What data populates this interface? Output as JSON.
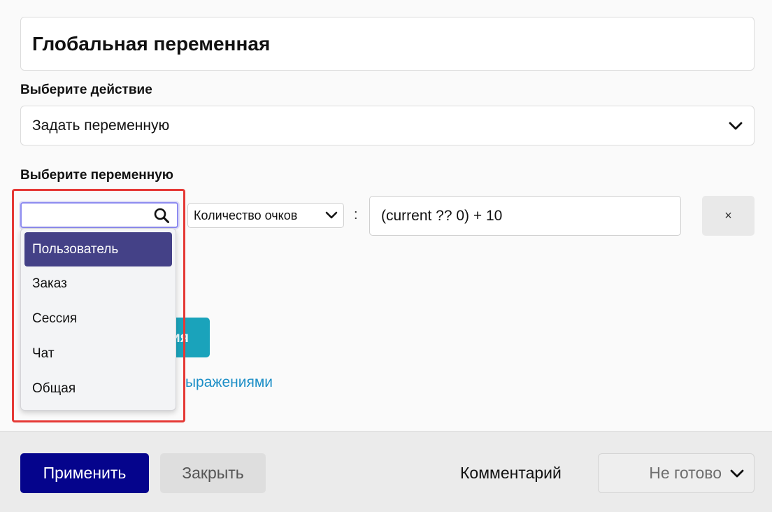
{
  "header": {
    "title": "Глобальная переменная"
  },
  "action": {
    "label": "Выберите действие",
    "selected": "Задать переменную"
  },
  "variable": {
    "label": "Выберите переменную",
    "search_value": "",
    "search_placeholder": "",
    "scope_options": [
      {
        "label": "Пользователь",
        "selected": true
      },
      {
        "label": "Заказ",
        "selected": false
      },
      {
        "label": "Сессия",
        "selected": false
      },
      {
        "label": "Чат",
        "selected": false
      },
      {
        "label": "Общая",
        "selected": false
      }
    ],
    "name_selected": "Количество очков",
    "separator": ":",
    "expression": "(current ?? 0) + 10",
    "remove_label": "×"
  },
  "hidden_behind": {
    "add_button_fragment": "ия",
    "help_link_fragment": "ыражениями"
  },
  "footer": {
    "apply_label": "Применить",
    "close_label": "Закрыть",
    "comment_label": "Комментарий",
    "status_selected": "Не готово"
  },
  "icons": {
    "search": "search-icon",
    "chevron": "chevron-down-icon",
    "close": "close-icon"
  },
  "colors": {
    "primary": "#05048c",
    "selected_option": "#444187",
    "teal": "#1aa3bb",
    "link": "#1d8fc7",
    "highlight": "#e53935"
  }
}
